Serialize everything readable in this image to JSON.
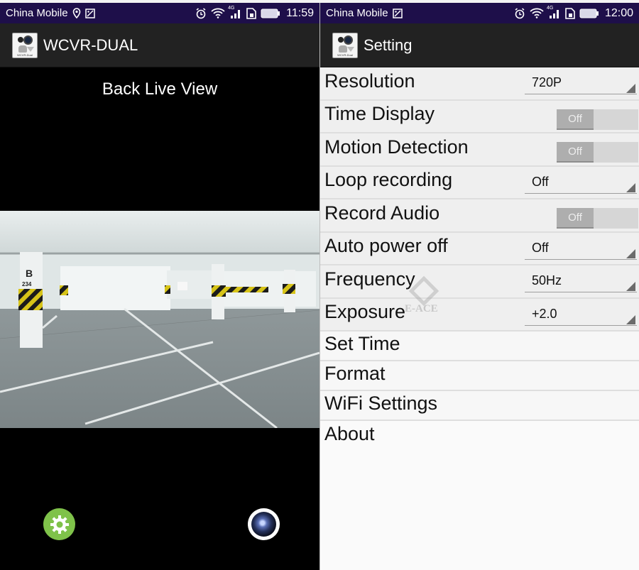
{
  "left_screen": {
    "status_bar": {
      "carrier": "China Mobile",
      "icons": [
        "location-icon",
        "image-icon",
        "alarm-icon",
        "wifi-icon",
        "4g-signal-icon",
        "sim-icon",
        "battery-icon"
      ],
      "network_label": "4G",
      "time": "11:59"
    },
    "app_bar": {
      "icon_label": "WCVR-Dual",
      "title": "WCVR-DUAL"
    },
    "live_view": {
      "title": "Back Live View",
      "camera_feed": {
        "description": "Underground parking garage with yellow-black striped pillars",
        "pillar_labels": [
          "B",
          "234"
        ]
      }
    },
    "controls": {
      "settings_icon": "gear-icon",
      "capture_icon": "camera-lens-icon"
    },
    "colors": {
      "status_bar_bg": "#1e0f4a",
      "app_bar_bg": "#222222",
      "settings_button": "#7fc24a"
    }
  },
  "right_screen": {
    "status_bar": {
      "carrier": "China Mobile",
      "icons": [
        "image-icon",
        "alarm-icon",
        "wifi-icon",
        "4g-signal-icon",
        "sim-icon",
        "battery-icon"
      ],
      "network_label": "4G",
      "time": "12:00"
    },
    "app_bar": {
      "icon_label": "WCVR-Dual",
      "title": "Setting"
    },
    "settings": [
      {
        "label": "Resolution",
        "type": "spinner",
        "value": "720P"
      },
      {
        "label": "Time Display",
        "type": "toggle",
        "value": "Off"
      },
      {
        "label": "Motion Detection",
        "type": "toggle",
        "value": "Off"
      },
      {
        "label": "Loop recording",
        "type": "spinner",
        "value": "Off"
      },
      {
        "label": "Record Audio",
        "type": "toggle",
        "value": "Off"
      },
      {
        "label": "Auto power off",
        "type": "spinner",
        "value": "Off"
      },
      {
        "label": "Frequency",
        "type": "spinner",
        "value": "50Hz"
      },
      {
        "label": "Exposure",
        "type": "spinner",
        "value": "+2.0"
      },
      {
        "label": "Set Time",
        "type": "action"
      },
      {
        "label": "Format",
        "type": "action"
      },
      {
        "label": "WiFi Settings",
        "type": "action"
      },
      {
        "label": "About",
        "type": "action"
      }
    ],
    "watermark": "E-ACE"
  }
}
